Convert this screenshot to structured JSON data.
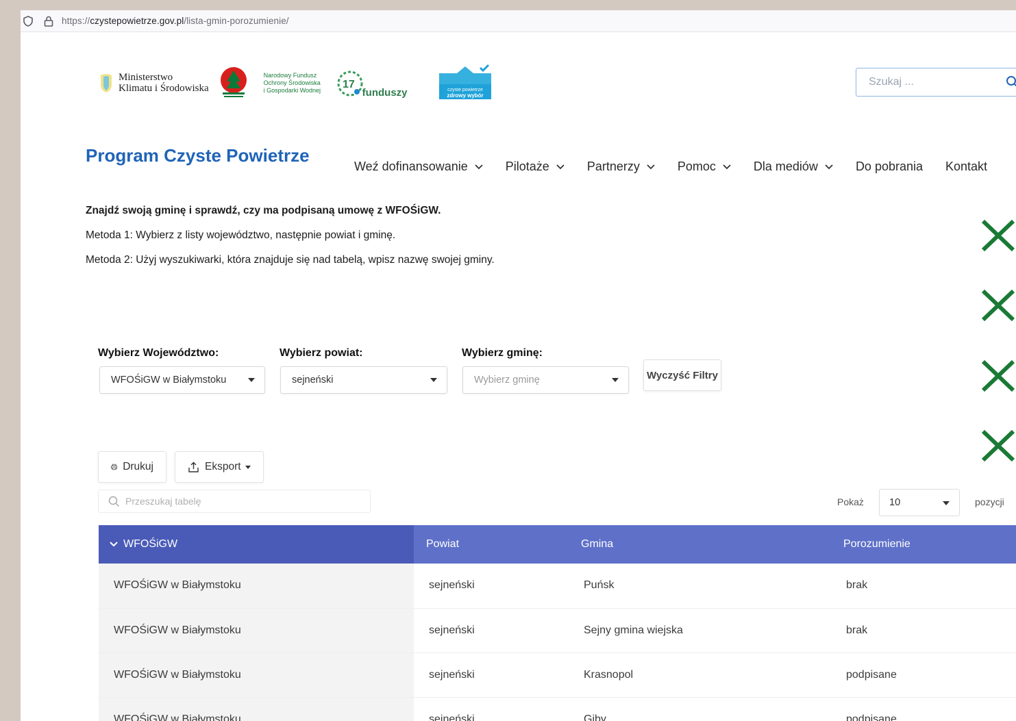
{
  "browser": {
    "url_prefix": "https://",
    "url_domain": "czystepowietrze.gov.pl",
    "url_path": "/lista-gmin-porozumienie/"
  },
  "header": {
    "logo_ministry_line1": "Ministerstwo",
    "logo_ministry_line2": "Klimatu i Środowiska",
    "logo_nfos_line1": "Narodowy Fundusz",
    "logo_nfos_line2": "Ochrony Środowiska",
    "logo_nfos_line3": "i Gospodarki Wodnej",
    "logo_17": "17",
    "logo_17_text": "funduszy",
    "logo_cp_line1": "czyste powietrze",
    "logo_cp_line2": "zdrowy wybór",
    "search_placeholder": "Szukaj ..."
  },
  "site_title": "Program Czyste Powietrze",
  "nav": {
    "items": [
      {
        "label": "Weź dofinansowanie",
        "has_dropdown": true
      },
      {
        "label": "Pilotaże",
        "has_dropdown": true
      },
      {
        "label": "Partnerzy",
        "has_dropdown": true
      },
      {
        "label": "Pomoc",
        "has_dropdown": true
      },
      {
        "label": "Dla mediów",
        "has_dropdown": true
      },
      {
        "label": "Do pobrania",
        "has_dropdown": false
      },
      {
        "label": "Kontakt",
        "has_dropdown": false
      }
    ]
  },
  "intro": {
    "heading": "Znajdź swoją gminę i sprawdź, czy ma podpisaną umowę z WFOŚiGW.",
    "method1": "Metoda 1: Wybierz z listy województwo, następnie powiat i gminę.",
    "method2": "Metoda 2: Użyj wyszukiwarki, która znajduje się nad tabelą, wpisz nazwę swojej gminy."
  },
  "markers": {
    "x_color": "#1a7a35",
    "count": 4
  },
  "filters": {
    "voivodeship_label": "Wybierz Województwo:",
    "voivodeship_value": "WFOŚiGW w Białymstoku",
    "county_label": "Wybierz powiat:",
    "county_value": "sejneński",
    "commune_label": "Wybierz gminę:",
    "commune_placeholder": "Wybierz gminę",
    "clear_label": "Wyczyść Filtry"
  },
  "toolbar": {
    "print_label": "Drukuj",
    "export_label": "Eksport",
    "table_search_placeholder": "Przeszukaj tabelę",
    "show_label": "Pokaż",
    "page_size": "10",
    "positions_label": "pozycji"
  },
  "table": {
    "headers": [
      "WFOŚiGW",
      "Powiat",
      "Gmina",
      "Porozumienie"
    ],
    "header_colors": {
      "first": "#4a5bb7",
      "rest": "#5e70c8"
    },
    "rows": [
      {
        "wfos": "WFOŚiGW w Białymstoku",
        "powiat": "sejneński",
        "gmina": "Puńsk",
        "porozumienie": "brak"
      },
      {
        "wfos": "WFOŚiGW w Białymstoku",
        "powiat": "sejneński",
        "gmina": "Sejny gmina wiejska",
        "porozumienie": "brak"
      },
      {
        "wfos": "WFOŚiGW w Białymstoku",
        "powiat": "sejneński",
        "gmina": "Krasnopol",
        "porozumienie": "podpisane"
      },
      {
        "wfos": "WFOŚiGW w Białymstoku",
        "powiat": "sejneński",
        "gmina": "Giby",
        "porozumienie": "podpisane"
      }
    ]
  }
}
